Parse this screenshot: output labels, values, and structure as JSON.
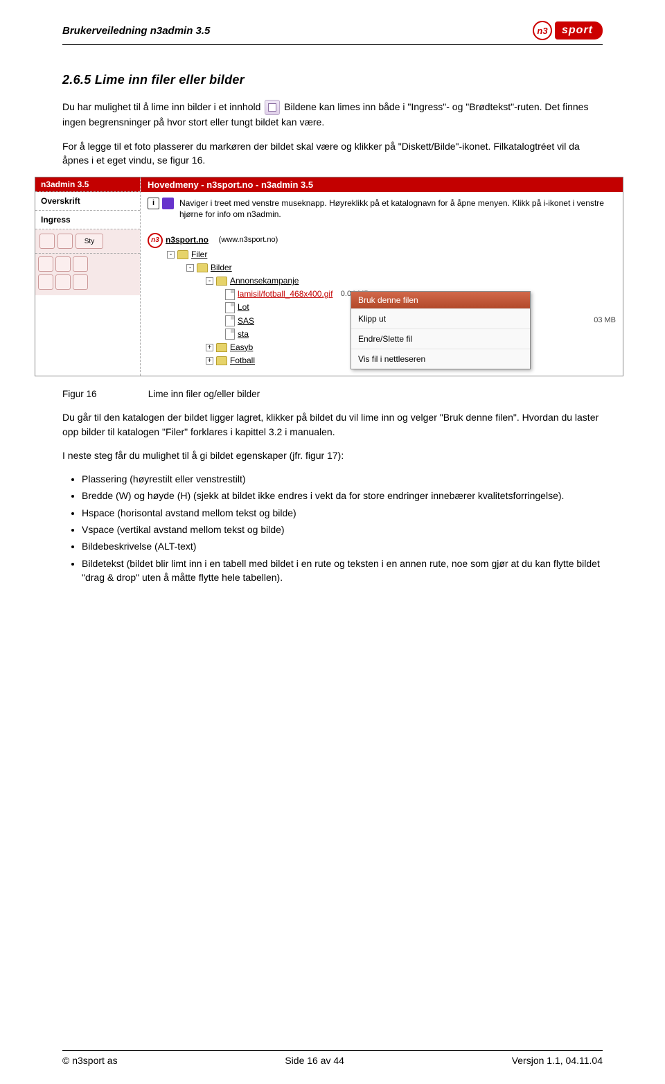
{
  "doc": {
    "title": "Brukerveiledning n3admin 3.5",
    "logo_code": "n3",
    "logo_text": "sport"
  },
  "section": {
    "heading": "2.6.5 Lime inn filer eller bilder",
    "p1a": "Du har mulighet til å lime inn bilder i et innhold",
    "p1b": "Bildene kan limes inn både i \"Ingress\"- og \"Brødtekst\"-ruten. Det finnes ingen begrensninger på hvor stort eller tungt bildet kan være.",
    "p2": "For å legge til et foto plasserer du markøren der bildet skal være og klikker på \"Diskett/Bilde\"-ikonet. Filkatalogtréet vil da åpnes i et eget vindu, se figur 16."
  },
  "sidebar": {
    "version": "n3admin 3.5",
    "heading1": "Overskrift",
    "heading2": "Ingress",
    "btn_styl": "Sty"
  },
  "main": {
    "title": "Hovedmeny - n3sport.no - n3admin 3.5",
    "help": "Naviger i treet med venstre museknapp. Høyreklikk på et katalognavn for å åpne menyen. Klikk på i-ikonet i venstre hjørne for info om n3admin.",
    "root_label": "n3sport.no",
    "root_url": "(www.n3sport.no)",
    "tree": {
      "filer": "Filer",
      "bilder": "Bilder",
      "annonse": "Annonsekampanje",
      "file1": "lamisil/fotball_468x400.gif",
      "file1_size": "0.04 MB",
      "file2": "Lot",
      "file3": "SAS",
      "file3_size": "03 MB",
      "file4": "sta",
      "easyb": "Easyb",
      "fotball": "Fotball"
    }
  },
  "contextmenu": {
    "header": "Bruk denne filen",
    "item1": "Klipp ut",
    "item2": "Endre/Slette fil",
    "item3": "Vis fil i nettleseren"
  },
  "fig": {
    "no": "Figur 16",
    "caption": "Lime inn filer og/eller bilder"
  },
  "after": {
    "p1": "Du går til den katalogen der bildet ligger lagret, klikker på bildet du vil lime inn og velger \"Bruk denne filen\". Hvordan du laster opp bilder til katalogen \"Filer\" forklares i kapittel 3.2 i manualen.",
    "p2": "I neste steg får du mulighet til å gi bildet egenskaper (jfr. figur 17):"
  },
  "bullets": {
    "b1": "Plassering (høyrestilt eller venstrestilt)",
    "b2": "Bredde (W) og høyde (H) (sjekk at bildet ikke endres i vekt da for store endringer innebærer kvalitetsforringelse).",
    "b3": "Hspace (horisontal avstand mellom tekst og bilde)",
    "b4": "Vspace (vertikal avstand mellom tekst og bilde)",
    "b5": "Bildebeskrivelse (ALT-text)",
    "b6": "Bildetekst (bildet blir limt inn i en tabell med bildet i en rute og teksten i en annen rute, noe som gjør at du kan flytte bildet \"drag & drop\" uten å måtte flytte hele tabellen)."
  },
  "footer": {
    "left": "© n3sport as",
    "center": "Side 16 av 44",
    "right": "Versjon 1.1, 04.11.04"
  }
}
